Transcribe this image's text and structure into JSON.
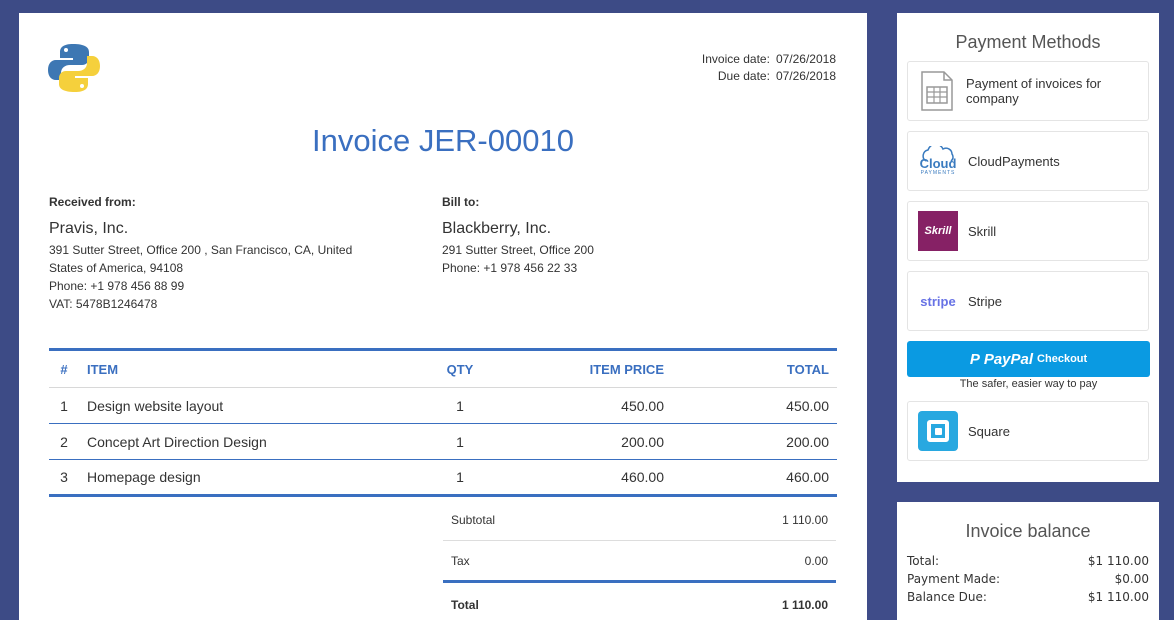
{
  "invoice": {
    "dates": [
      {
        "label": "Invoice date:",
        "value": "07/26/2018"
      },
      {
        "label": "Due date:",
        "value": "07/26/2018"
      }
    ],
    "title": "Invoice JER-00010",
    "from": {
      "header": "Received from:",
      "name": "Pravis, Inc.",
      "address": "391 Sutter Street, Office 200 , San Francisco, CA, United States of America, 94108",
      "phone": "Phone: +1 978 456 88 99",
      "vat": "VAT: 5478B1246478"
    },
    "to": {
      "header": "Bill to:",
      "name": "Blackberry, Inc.",
      "address": "291 Sutter Street, Office 200",
      "phone": "Phone: +1 978 456 22 33"
    },
    "columns": {
      "num": "#",
      "item": "ITEM",
      "qty": "QTY",
      "price": "ITEM PRICE",
      "total": "TOTAL"
    },
    "items": [
      {
        "num": "1",
        "item": "Design website layout",
        "qty": "1",
        "price": "450.00",
        "total": "450.00"
      },
      {
        "num": "2",
        "item": "Concept Art Direction Design",
        "qty": "1",
        "price": "200.00",
        "total": "200.00"
      },
      {
        "num": "3",
        "item": "Homepage design",
        "qty": "1",
        "price": "460.00",
        "total": "460.00"
      }
    ],
    "totals": {
      "subtotal_label": "Subtotal",
      "subtotal": "1 110.00",
      "tax_label": "Tax",
      "tax": "0.00",
      "total_label": "Total",
      "total": "1 110.00"
    }
  },
  "payment_methods": {
    "title": "Payment Methods",
    "items": [
      {
        "label": "Payment of invoices for company",
        "icon": "invoice-document-icon"
      },
      {
        "label": "CloudPayments",
        "icon": "cloudpayments-logo"
      },
      {
        "label": "Skrill",
        "icon": "skrill-logo"
      },
      {
        "label": "Stripe",
        "icon": "stripe-logo"
      },
      {
        "label": "Square",
        "icon": "square-logo"
      }
    ],
    "cloud_logo_text": "Cloud",
    "cloud_logo_sub": "PAYMENTS",
    "skrill_logo_text": "Skrill",
    "stripe_logo_text": "stripe",
    "paypal": {
      "brand": "PayPal",
      "sub": "Checkout",
      "tagline": "The safer, easier way to pay"
    }
  },
  "balance": {
    "title": "Invoice balance",
    "rows": [
      {
        "label": "Total:",
        "value": "$1 110.00"
      },
      {
        "label": "Payment Made:",
        "value": "$0.00"
      },
      {
        "label": "Balance Due:",
        "value": "$1 110.00"
      }
    ]
  },
  "colors": {
    "accent": "#3a6fc0",
    "background": "#3d4b86",
    "paypal": "#0a9ae2",
    "skrill": "#862165",
    "square": "#28a8e0"
  }
}
